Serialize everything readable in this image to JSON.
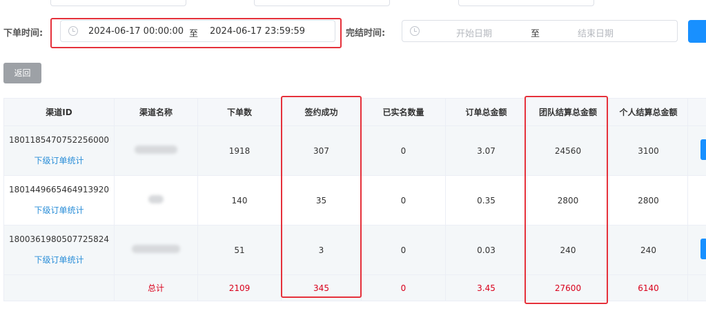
{
  "filters": {
    "order_time_label": "下单时间:",
    "order_time_start": "2024-06-17 00:00:00",
    "order_time_sep": "至",
    "order_time_end": "2024-06-17 23:59:59",
    "finish_time_label": "完结时间:",
    "finish_time_start_placeholder": "开始日期",
    "finish_time_sep": "至",
    "finish_time_end_placeholder": "结束日期"
  },
  "actions": {
    "return_label": "返回"
  },
  "table": {
    "headers": [
      "渠道ID",
      "渠道名称",
      "下单数",
      "签约成功",
      "已实名数量",
      "订单总金额",
      "团队结算总金额",
      "个人结算总金额"
    ],
    "rows": [
      {
        "channel_id": "1801185470752256000",
        "link": "下级订单统计",
        "orders": "1918",
        "signed": "307",
        "verified": "0",
        "total_amount": "3.07",
        "team_settle": "24560",
        "personal_settle": "3100"
      },
      {
        "channel_id": "1801449665464913920",
        "link": "下级订单统计",
        "orders": "140",
        "signed": "35",
        "verified": "0",
        "total_amount": "0.35",
        "team_settle": "2800",
        "personal_settle": "2800"
      },
      {
        "channel_id": "1800361980507725824",
        "link": "下级订单统计",
        "orders": "51",
        "signed": "3",
        "verified": "0",
        "total_amount": "0.03",
        "team_settle": "240",
        "personal_settle": "240"
      }
    ],
    "total": {
      "label": "总计",
      "orders": "2109",
      "signed": "345",
      "verified": "0",
      "total_amount": "3.45",
      "team_settle": "27600",
      "personal_settle": "6140"
    }
  },
  "colors": {
    "highlight": "#e5303a",
    "link": "#2a8ed8",
    "total_text": "#d9001b",
    "primary": "#1890ff"
  }
}
